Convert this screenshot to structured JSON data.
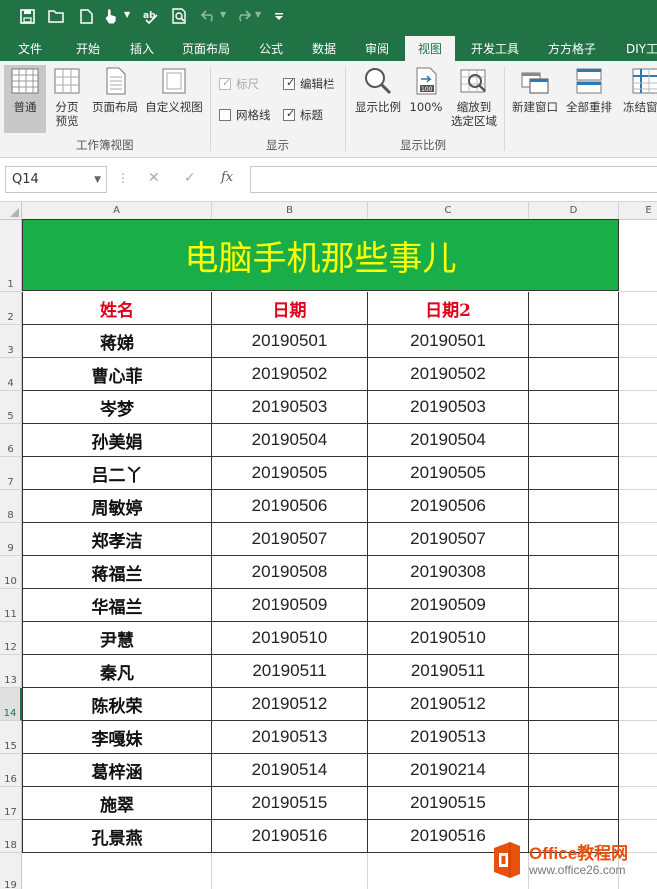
{
  "tabs": [
    "文件",
    "开始",
    "插入",
    "页面布局",
    "公式",
    "数据",
    "审阅",
    "视图",
    "开发工具",
    "方方格子",
    "DIY工"
  ],
  "active_tab": "视图",
  "ribbon": {
    "workbook_views": {
      "label": "工作簿视图",
      "normal": "普通",
      "page_break_1": "分页",
      "page_break_2": "预览",
      "page_layout": "页面布局",
      "custom_views": "自定义视图"
    },
    "show": {
      "label": "显示",
      "ruler": "标尺",
      "formula_bar": "编辑栏",
      "gridlines": "网格线",
      "headings": "标题"
    },
    "zoom": {
      "label": "显示比例",
      "zoom": "显示比例",
      "hundred": "100%",
      "hundred_icon_text": "100",
      "zoom_selection_1": "缩放到",
      "zoom_selection_2": "选定区域"
    },
    "window": {
      "new_window": "新建窗口",
      "arrange_all": "全部重排",
      "freeze_panes": "冻结窗格"
    }
  },
  "formula_bar": {
    "name_box": "Q14",
    "fx": "fx",
    "value": ""
  },
  "columns": [
    "A",
    "B",
    "C",
    "D",
    "E"
  ],
  "rows": [
    "1",
    "2",
    "3",
    "4",
    "5",
    "6",
    "7",
    "8",
    "9",
    "10",
    "11",
    "12",
    "13",
    "14",
    "15",
    "16",
    "17",
    "18",
    "19"
  ],
  "selected_row": "14",
  "sheet": {
    "title": "电脑手机那些事儿",
    "headers": [
      "姓名",
      "日期",
      "日期2"
    ],
    "data": [
      [
        "蒋娣",
        "20190501",
        "20190501"
      ],
      [
        "曹心菲",
        "20190502",
        "20190502"
      ],
      [
        "岑梦",
        "20190503",
        "20190503"
      ],
      [
        "孙美娟",
        "20190504",
        "20190504"
      ],
      [
        "吕二丫",
        "20190505",
        "20190505"
      ],
      [
        "周敏婷",
        "20190506",
        "20190506"
      ],
      [
        "郑孝洁",
        "20190507",
        "20190507"
      ],
      [
        "蒋福兰",
        "20190508",
        "20190308"
      ],
      [
        "华福兰",
        "20190509",
        "20190509"
      ],
      [
        "尹慧",
        "20190510",
        "20190510"
      ],
      [
        "秦凡",
        "20190511",
        "20190511"
      ],
      [
        "陈秋荣",
        "20190512",
        "20190512"
      ],
      [
        "李嘎妹",
        "20190513",
        "20190513"
      ],
      [
        "葛梓涵",
        "20190514",
        "20190214"
      ],
      [
        "施翠",
        "20190515",
        "20190515"
      ],
      [
        "孔景燕",
        "20190516",
        "20190516"
      ]
    ]
  },
  "watermark": {
    "brand": "Office教程网",
    "url": "www.office26.com"
  },
  "colors": {
    "excel_green": "#217346",
    "title_fill": "#1aae48",
    "title_text": "#ffff00",
    "header_text": "#e0001a"
  }
}
